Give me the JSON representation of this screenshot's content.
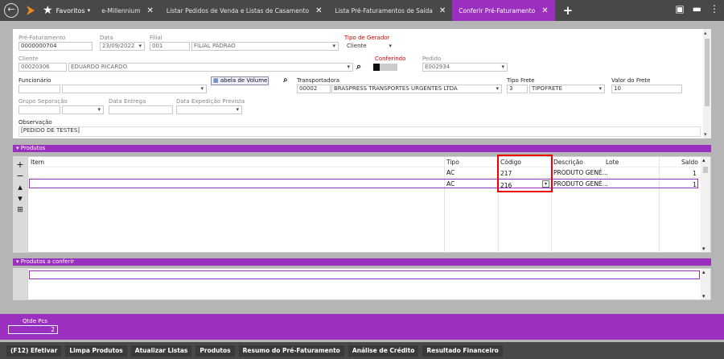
{
  "topbar": {
    "favorites_label": "Favoritos",
    "tabs": [
      {
        "label": "e-Millennium"
      },
      {
        "label": "Listar Pedidos de Venda e Listas de Casamento"
      },
      {
        "label": "Lista Pré-Faturamentos de Saída"
      },
      {
        "label": "Conferir Pré-Faturamento"
      }
    ],
    "close_glyph": "✕",
    "accent": "#9b2fc0"
  },
  "form": {
    "pre_faturamento": {
      "label": "Pré-Faturamento",
      "value": "0000000704"
    },
    "data": {
      "label": "Data",
      "value": "23/09/2022"
    },
    "filial": {
      "label": "Filial",
      "code": "001",
      "name": "FILIAL PADRÃO"
    },
    "tipo_gerador": {
      "label": "Tipo de Gerador",
      "value": "Cliente"
    },
    "cliente": {
      "label": "Cliente",
      "code": "00020306",
      "name": "EDUARDO RICARDO"
    },
    "conferindo": {
      "label": "Conferindo"
    },
    "pedido": {
      "label": "Pedido",
      "value": "E002934"
    },
    "funcionario": {
      "label": "Funcionário"
    },
    "tabela_volume": {
      "label": "abela de Volume"
    },
    "transportadora": {
      "label": "Transportadora",
      "code": "00002",
      "name": "BRASPRESS TRANSPORTES URGENTES LTDA"
    },
    "tipo_frete": {
      "label": "Tipo Frete",
      "code": "3",
      "name": "TIPOFRETE"
    },
    "valor_frete": {
      "label": "Valor do Frete",
      "value": "10"
    },
    "grupo_separacao": {
      "label": "Grupo Separação"
    },
    "data_entrega": {
      "label": "Data Entrega"
    },
    "data_expedicao": {
      "label": "Data Expedição Prevista"
    },
    "observacao": {
      "label": "Observação",
      "value": "[PEDIDO DE TESTES]"
    }
  },
  "produtos": {
    "section_label": "Produtos",
    "columns": [
      "Item",
      "Tipo",
      "Código",
      "Descrição",
      "Lote",
      "Saldo"
    ],
    "rows": [
      {
        "tipo": "AC",
        "codigo": "217",
        "descricao": "PRODUTO GENÉ...",
        "saldo": "1"
      },
      {
        "tipo": "AC",
        "codigo": "216",
        "descricao": "PRODUTO GENÉ...",
        "saldo": "1"
      }
    ]
  },
  "produtos_conferir": {
    "section_label": "Produtos a conferir"
  },
  "qtd": {
    "label": "Qtde Pcs",
    "value": "2"
  },
  "buttons": {
    "efetivar": "(F12) Efetivar",
    "limpa": "Limpa Produtos",
    "atualizar": "Atualizar Listas",
    "produtos": "Produtos",
    "resumo": "Resumo do Pré-Faturamento",
    "credito": "Análise de Crédito",
    "financeiro": "Resultado Financeiro"
  }
}
